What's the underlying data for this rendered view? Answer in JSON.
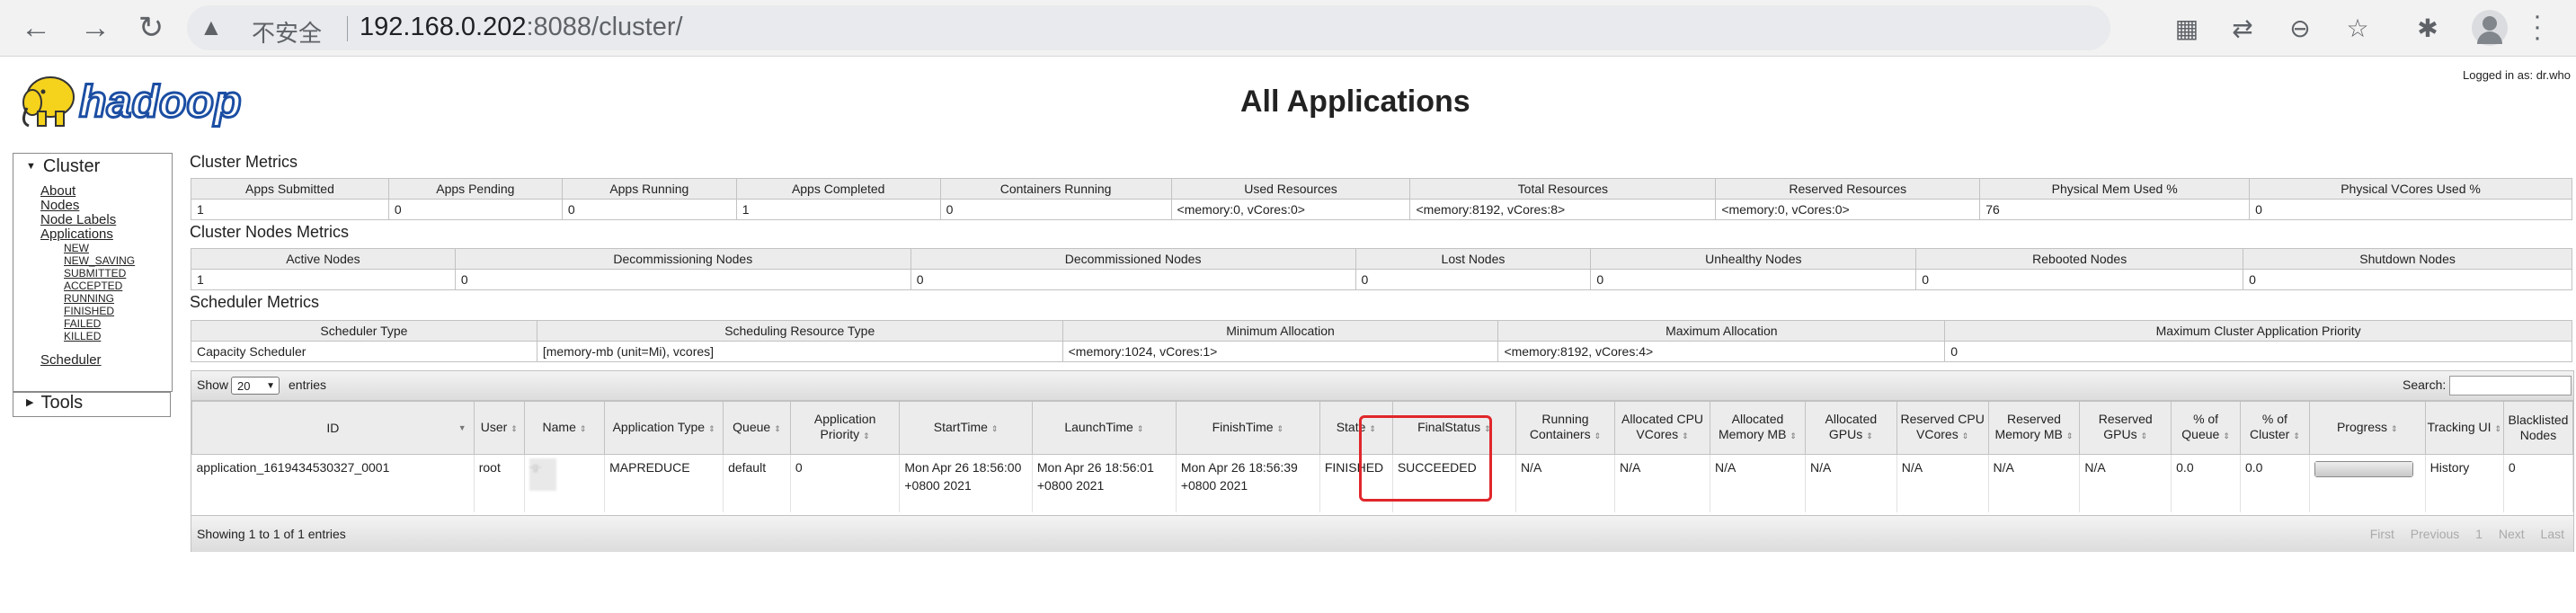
{
  "browser": {
    "insecure_label": "不安全",
    "url_host": "192.168.0.202",
    "url_rest": ":8088/cluster/"
  },
  "header": {
    "logged_in": "Logged in as: dr.who",
    "title": "All Applications",
    "logo_text": "hadoop"
  },
  "sidebar": {
    "cluster_label": "Cluster",
    "links": [
      "About",
      "Nodes",
      "Node Labels",
      "Applications"
    ],
    "app_states": [
      "NEW",
      "NEW_SAVING",
      "SUBMITTED",
      "ACCEPTED",
      "RUNNING",
      "FINISHED",
      "FAILED",
      "KILLED"
    ],
    "scheduler": "Scheduler",
    "tools_label": "Tools"
  },
  "cluster_metrics": {
    "title": "Cluster Metrics",
    "headers": [
      "Apps Submitted",
      "Apps Pending",
      "Apps Running",
      "Apps Completed",
      "Containers Running",
      "Used Resources",
      "Total Resources",
      "Reserved Resources",
      "Physical Mem Used %",
      "Physical VCores Used %"
    ],
    "values": [
      "1",
      "0",
      "0",
      "1",
      "0",
      "<memory:0, vCores:0>",
      "<memory:8192, vCores:8>",
      "<memory:0, vCores:0>",
      "76",
      "0"
    ]
  },
  "nodes_metrics": {
    "title": "Cluster Nodes Metrics",
    "headers": [
      "Active Nodes",
      "Decommissioning Nodes",
      "Decommissioned Nodes",
      "Lost Nodes",
      "Unhealthy Nodes",
      "Rebooted Nodes",
      "Shutdown Nodes"
    ],
    "values": [
      "1",
      "0",
      "0",
      "0",
      "0",
      "0",
      "0"
    ]
  },
  "scheduler_metrics": {
    "title": "Scheduler Metrics",
    "headers": [
      "Scheduler Type",
      "Scheduling Resource Type",
      "Minimum Allocation",
      "Maximum Allocation",
      "Maximum Cluster Application Priority"
    ],
    "values": [
      "Capacity Scheduler",
      "[memory-mb (unit=Mi), vcores]",
      "<memory:1024, vCores:1>",
      "<memory:8192, vCores:4>",
      "0"
    ]
  },
  "apps": {
    "show_label": "Show",
    "page_size": "20",
    "entries_label": "entries",
    "search_label": "Search:",
    "headers": [
      "ID",
      "User",
      "Name",
      "Application Type",
      "Queue",
      "Application Priority",
      "StartTime",
      "LaunchTime",
      "FinishTime",
      "State",
      "FinalStatus",
      "Running Containers",
      "Allocated CPU VCores",
      "Allocated Memory MB",
      "Allocated GPUs",
      "Reserved CPU VCores",
      "Reserved Memory MB",
      "Reserved GPUs",
      "% of Queue",
      "% of Cluster",
      "Progress",
      "Tracking UI",
      "Blacklisted Nodes"
    ],
    "row": {
      "id": "application_1619434530327_0001",
      "user": "root",
      "name_visible": "-g-",
      "app_type": "MAPREDUCE",
      "queue": "default",
      "priority": "0",
      "start_time": "Mon Apr 26 18:56:00 +0800 2021",
      "launch_time": "Mon Apr 26 18:56:01 +0800 2021",
      "finish_time": "Mon Apr 26 18:56:39 +0800 2021",
      "state": "FINISHED",
      "final_status": "SUCCEEDED",
      "running_containers": "N/A",
      "alloc_vcores": "N/A",
      "alloc_mem": "N/A",
      "alloc_gpus": "N/A",
      "res_vcores": "N/A",
      "res_mem": "N/A",
      "res_gpus": "N/A",
      "pct_queue": "0.0",
      "pct_cluster": "0.0",
      "progress": 1.0,
      "tracking": "History",
      "blacklisted": "0"
    },
    "showing": "Showing 1 to 1 of 1 entries",
    "pager": [
      "First",
      "Previous",
      "1",
      "Next",
      "Last"
    ]
  },
  "colors": {
    "highlight": "#e0262b",
    "logo_yellow": "#f5d21c",
    "logo_blue": "#1b4ea3"
  }
}
